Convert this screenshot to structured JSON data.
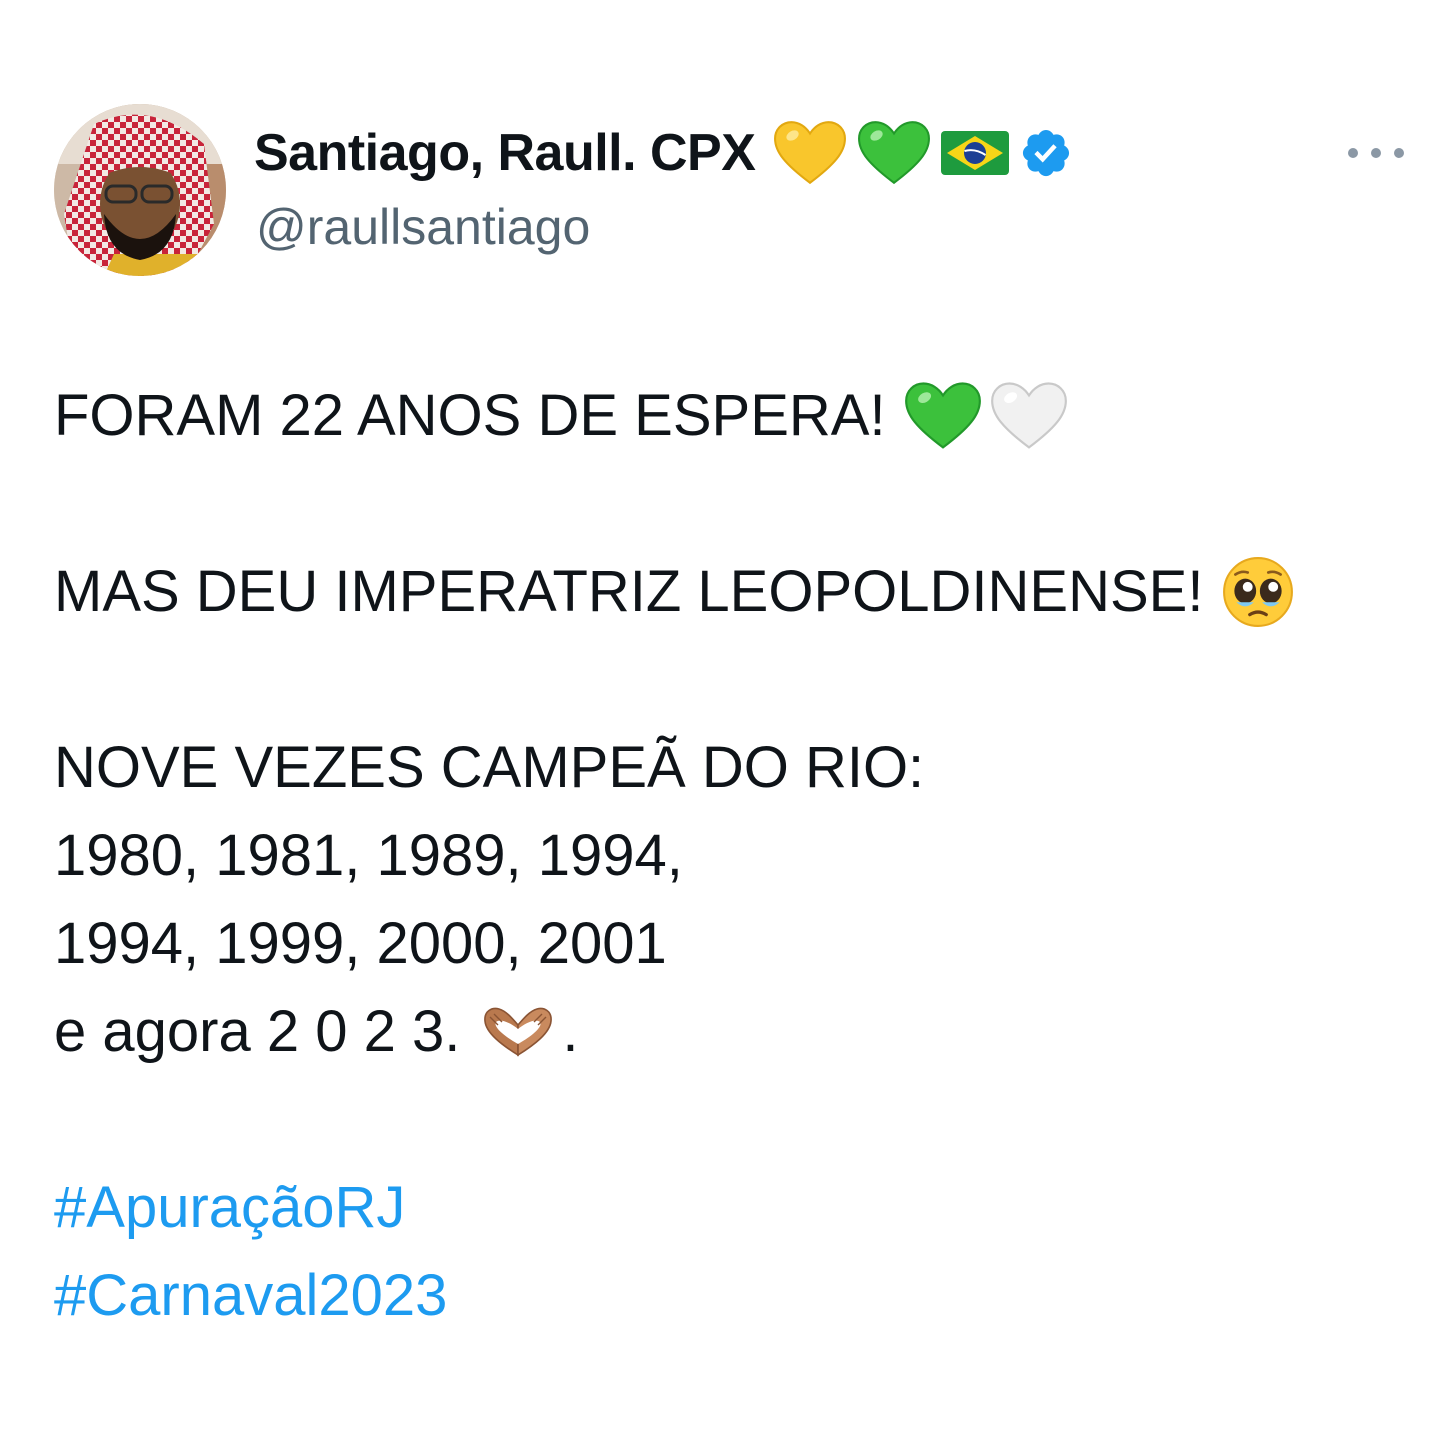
{
  "tweet": {
    "author": {
      "display_name": "Santiago, Raull. CPX",
      "name_emojis": [
        "yellow-heart",
        "green-heart",
        "brazil-flag"
      ],
      "verified": true,
      "handle": "@raullsantiago"
    },
    "lines": [
      "FORAM 22 ANOS DE ESPERA!",
      "MAS DEU IMPERATRIZ LEOPOLDINENSE!",
      "NOVE VEZES CAMPEÃ DO RIO:",
      "1980, 1981, 1989, 1994,",
      "1994, 1999, 2000, 2001",
      "e agora 2 0 2 3.",
      "."
    ],
    "hashtags": [
      "#ApuraçãoRJ",
      "#Carnaval2023"
    ]
  },
  "colors": {
    "text": "#0f1419",
    "secondary": "#536471",
    "link": "#1d9bf0",
    "verified": "#1d9bf0"
  }
}
